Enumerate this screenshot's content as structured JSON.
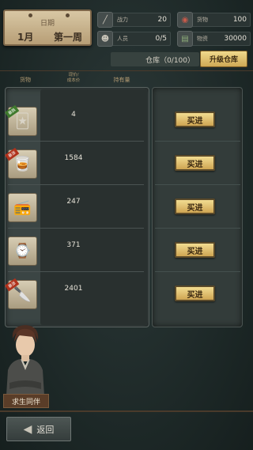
{
  "date": {
    "label": "日期",
    "month": "1月",
    "week": "第一周"
  },
  "stats": [
    {
      "icon": "rifle-icon",
      "label": "战力",
      "value": "20"
    },
    {
      "icon": "meat-icon",
      "label": "货物",
      "value": "100"
    },
    {
      "icon": "survivor-icon",
      "label": "人员",
      "value": "0/5"
    },
    {
      "icon": "cash-icon",
      "label": "物资",
      "value": "30000"
    }
  ],
  "warehouse": {
    "text": "仓库（0/100）",
    "upgrade_label": "升级仓库"
  },
  "table": {
    "col_goods": "货物",
    "col_price": "现价/\n成本价",
    "col_hold": "持有量"
  },
  "items": [
    {
      "name": "cards-icon",
      "tag": "暴跌",
      "tag_color": "#3f7a2d",
      "price": "4",
      "buy_label": "买进"
    },
    {
      "name": "whiskey-icon",
      "tag": "暴涨",
      "tag_color": "#b0321c",
      "price": "1584",
      "buy_label": "买进"
    },
    {
      "name": "radio-icon",
      "tag": "",
      "tag_color": "",
      "price": "247",
      "buy_label": "买进"
    },
    {
      "name": "watch-icon",
      "tag": "",
      "tag_color": "",
      "price": "371",
      "buy_label": "买进"
    },
    {
      "name": "knife-icon",
      "tag": "暴涨",
      "tag_color": "#b0321c",
      "price": "2401",
      "buy_label": "买进"
    }
  ],
  "companion_label": "求生同伴",
  "back_label": "返回"
}
